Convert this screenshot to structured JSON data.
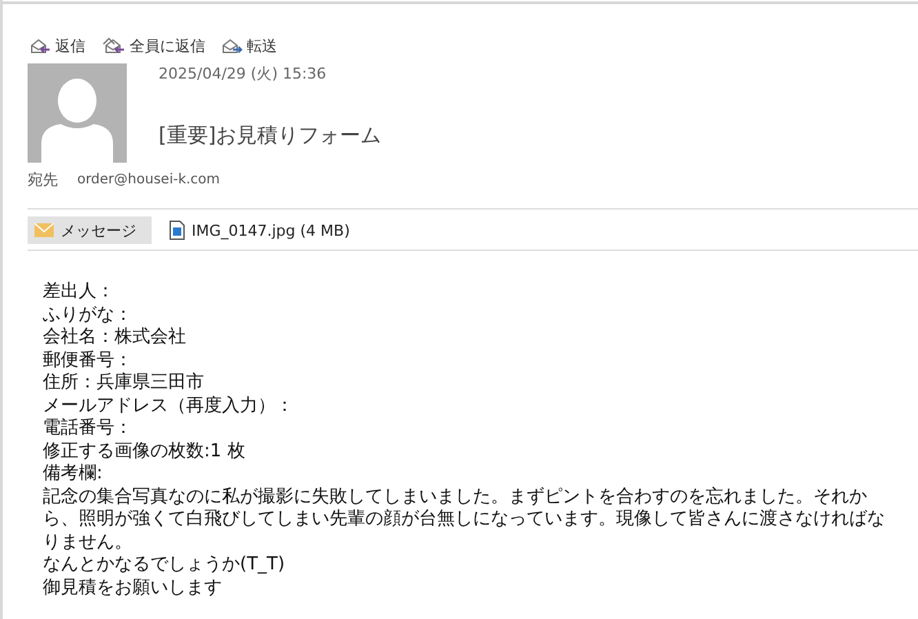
{
  "toolbar": [
    {
      "kind": "reply",
      "label": "返信"
    },
    {
      "kind": "reply_all",
      "label": "全員に返信"
    },
    {
      "kind": "forward",
      "label": "転送"
    }
  ],
  "message": {
    "date": "2025/04/29 (火) 15:36",
    "subject": "[重要]お見積りフォーム",
    "to_label": "宛先",
    "to": "order@housei-k.com"
  },
  "attachments": [
    {
      "kind": "message",
      "label": "メッセージ",
      "selected": true
    },
    {
      "kind": "file",
      "label": "IMG_0147.jpg (4 MB)",
      "selected": false
    }
  ],
  "body": [
    "差出人：",
    "ふりがな：",
    "会社名：株式会社",
    "郵便番号：",
    "住所：兵庫県三田市",
    "メールアドレス（再度入力）：",
    "電話番号：",
    "修正する画像の枚数:1 枚",
    "備考欄:",
    "記念の集合写真なのに私が撮影に失敗してしまいました。まずピントを合わすのを忘れました。それから、照明が強くて白飛びしてしまい先輩の顔が台無しになっています。現像して皆さんに渡さなければなりません。",
    "なんとかなるでしょうか(T_T)",
    "御見積をお願いします"
  ]
}
